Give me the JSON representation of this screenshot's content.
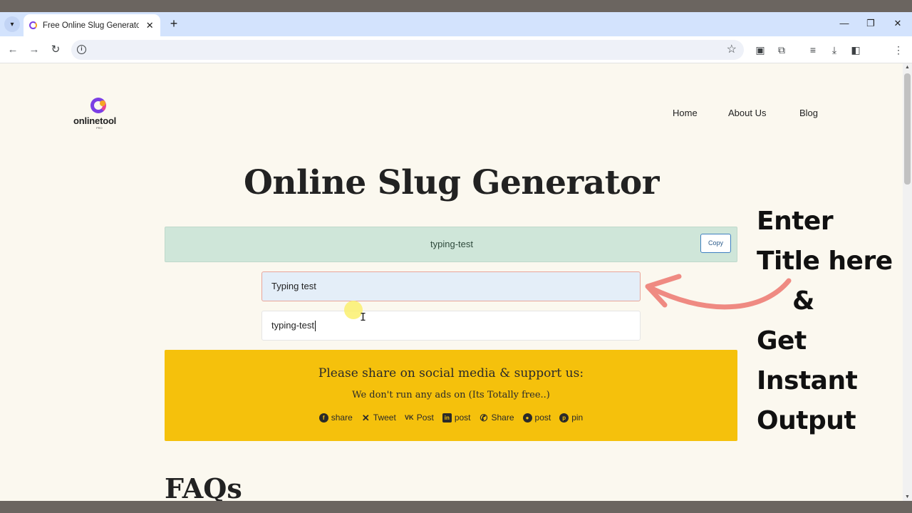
{
  "browser": {
    "tab_title": "Free Online Slug Generator | SE",
    "tab_close": "✕",
    "new_tab": "+",
    "window": {
      "minimize": "—",
      "restore": "❐",
      "close": "✕"
    },
    "address": ""
  },
  "site": {
    "logo_text": "onlinetool",
    "logo_sub": "PRO",
    "nav": [
      {
        "label": "Home"
      },
      {
        "label": "About Us"
      },
      {
        "label": "Blog"
      }
    ]
  },
  "main": {
    "title": "Online Slug Generator",
    "result": "typing-test",
    "copy_label": "Copy",
    "title_input_value": "Typing test",
    "slug_input_value": "typing-test"
  },
  "share": {
    "heading": "Please share on social media & support us:",
    "subheading": "We don't run any ads on (Its Totally free..)",
    "items": [
      {
        "icon": "facebook-icon",
        "label": "share"
      },
      {
        "icon": "x-icon",
        "label": "Tweet"
      },
      {
        "icon": "vk-icon",
        "label": "Post"
      },
      {
        "icon": "linkedin-icon",
        "label": "post"
      },
      {
        "icon": "whatsapp-icon",
        "label": "Share"
      },
      {
        "icon": "reddit-icon",
        "label": "post"
      },
      {
        "icon": "pinterest-icon",
        "label": "pin"
      }
    ]
  },
  "faq": {
    "title": "FAQs"
  },
  "annotation": {
    "lines": [
      "Enter",
      "Title here",
      "&",
      "Get",
      "Instant",
      "Output"
    ],
    "arrow_color": "#ef8a82"
  },
  "colors": {
    "page_bg": "#fbf8ef",
    "result_bg": "#cfe6d9",
    "share_bg": "#f5c10c",
    "brand_purple": "#7b3fe4"
  }
}
